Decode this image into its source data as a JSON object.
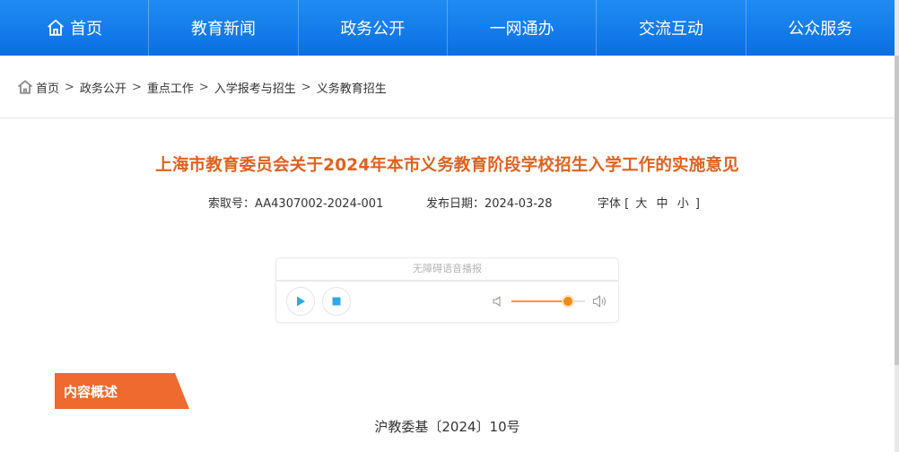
{
  "nav": {
    "items": [
      {
        "label": "首页",
        "icon": "home-icon"
      },
      {
        "label": "教育新闻"
      },
      {
        "label": "政务公开"
      },
      {
        "label": "一网通办"
      },
      {
        "label": "交流互动"
      },
      {
        "label": "公众服务"
      }
    ]
  },
  "breadcrumb": {
    "icon": "home-icon",
    "items": [
      "首页",
      "政务公开",
      "重点工作",
      "入学报考与招生",
      "义务教育招生"
    ],
    "separator": ">"
  },
  "article": {
    "title": "上海市教育委员会关于2024年本市义务教育阶段学校招生入学工作的实施意见",
    "index_label": "索取号：",
    "index_value": "AA4307002-2024-001",
    "date_label": "发布日期：",
    "date_value": "2024-03-28",
    "font_label": "字体",
    "font_open": "[",
    "font_large": "大",
    "font_medium": "中",
    "font_small": "小",
    "font_close": "]"
  },
  "player": {
    "caption": "无障碍语音播报",
    "play_icon": "play-icon",
    "stop_icon": "stop-icon",
    "volume_level": 0.77
  },
  "section": {
    "title": "内容概述",
    "doc_number": "沪教委基〔2024〕10号"
  },
  "colors": {
    "nav_bg": "#0a6fe2",
    "title": "#e0611f",
    "section_tag": "#ee6a2f",
    "player_accent": "#2fa8e8",
    "slider": "#f39a21"
  }
}
